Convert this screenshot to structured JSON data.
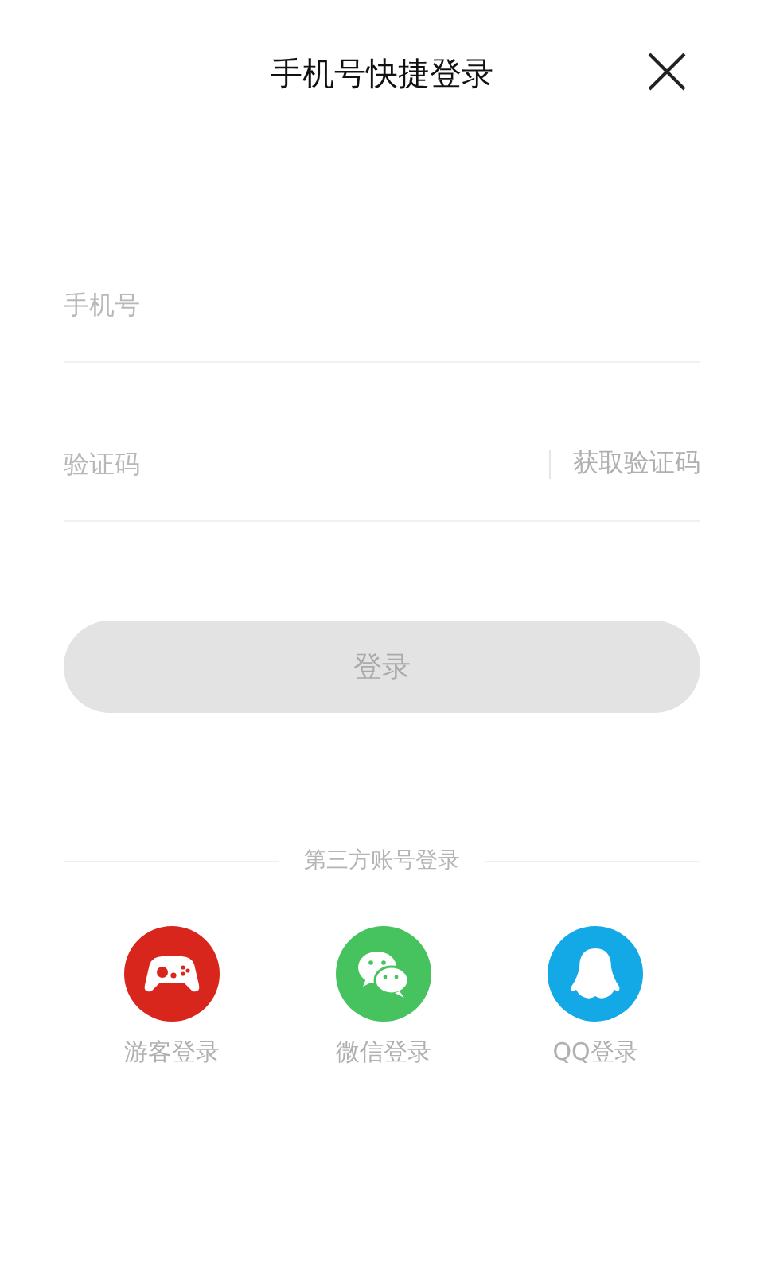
{
  "header": {
    "title": "手机号快捷登录"
  },
  "phone_field": {
    "placeholder": "手机号"
  },
  "code_field": {
    "placeholder": "验证码",
    "action": "获取验证码"
  },
  "login_button": {
    "label": "登录",
    "disabled": true
  },
  "third_party": {
    "title": "第三方账号登录",
    "options": [
      {
        "kind": "guest",
        "label": "游客登录",
        "color": "#d9261c"
      },
      {
        "kind": "wechat",
        "label": "微信登录",
        "color": "#46c35f"
      },
      {
        "kind": "qq",
        "label": "QQ登录",
        "color": "#13a8e6"
      }
    ]
  }
}
